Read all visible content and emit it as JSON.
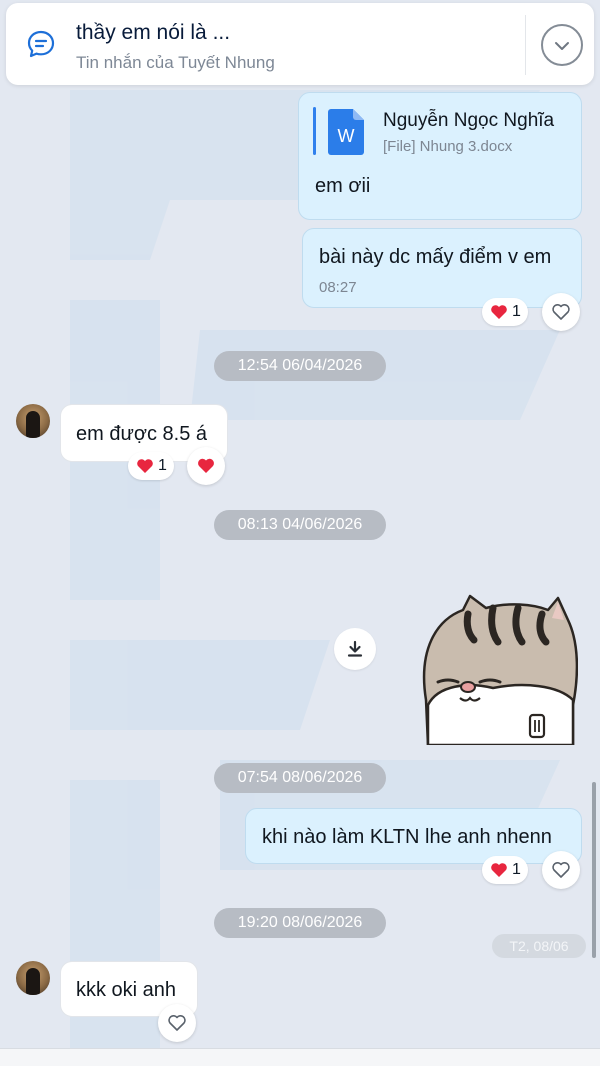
{
  "pinned": {
    "title": "thầy em nói là ...",
    "subtitle": "Tin nhắn của Tuyết Nhung",
    "icon": "pinned-message-icon",
    "expand_icon": "chevron-down-icon"
  },
  "messages": {
    "file_card": {
      "sender": "Nguyễn Ngọc Nghĩa",
      "file_name": "[File] Nhung 3.docx",
      "file_icon_letter": "W",
      "text": "em ơii"
    },
    "out_score_question": {
      "text": "bài này dc mấy điểm v em",
      "time": "08:27",
      "reaction_count": "1"
    },
    "date_1": "12:54 06/04/2026",
    "in_score_answer": {
      "text": "em được 8.5 á",
      "reaction_count": "1"
    },
    "date_2": "08:13 04/06/2026",
    "sticker": {
      "icon": "cat-sticker"
    },
    "download_icon": "download-icon",
    "date_3": "07:54 08/06/2026",
    "out_kltn": {
      "text": "khi nào làm KLTN lhe anh nhenn",
      "reaction_count": "1"
    },
    "date_4": "19:20 08/06/2026",
    "date_faint": "T2, 08/06",
    "in_oki": {
      "text": "kkk oki anh"
    }
  },
  "colors": {
    "background": "#e3e8f1",
    "outgoing_bubble": "#dbf1fe",
    "incoming_bubble": "#ffffff",
    "heart": "#e8263f",
    "accent": "#0068ff"
  }
}
